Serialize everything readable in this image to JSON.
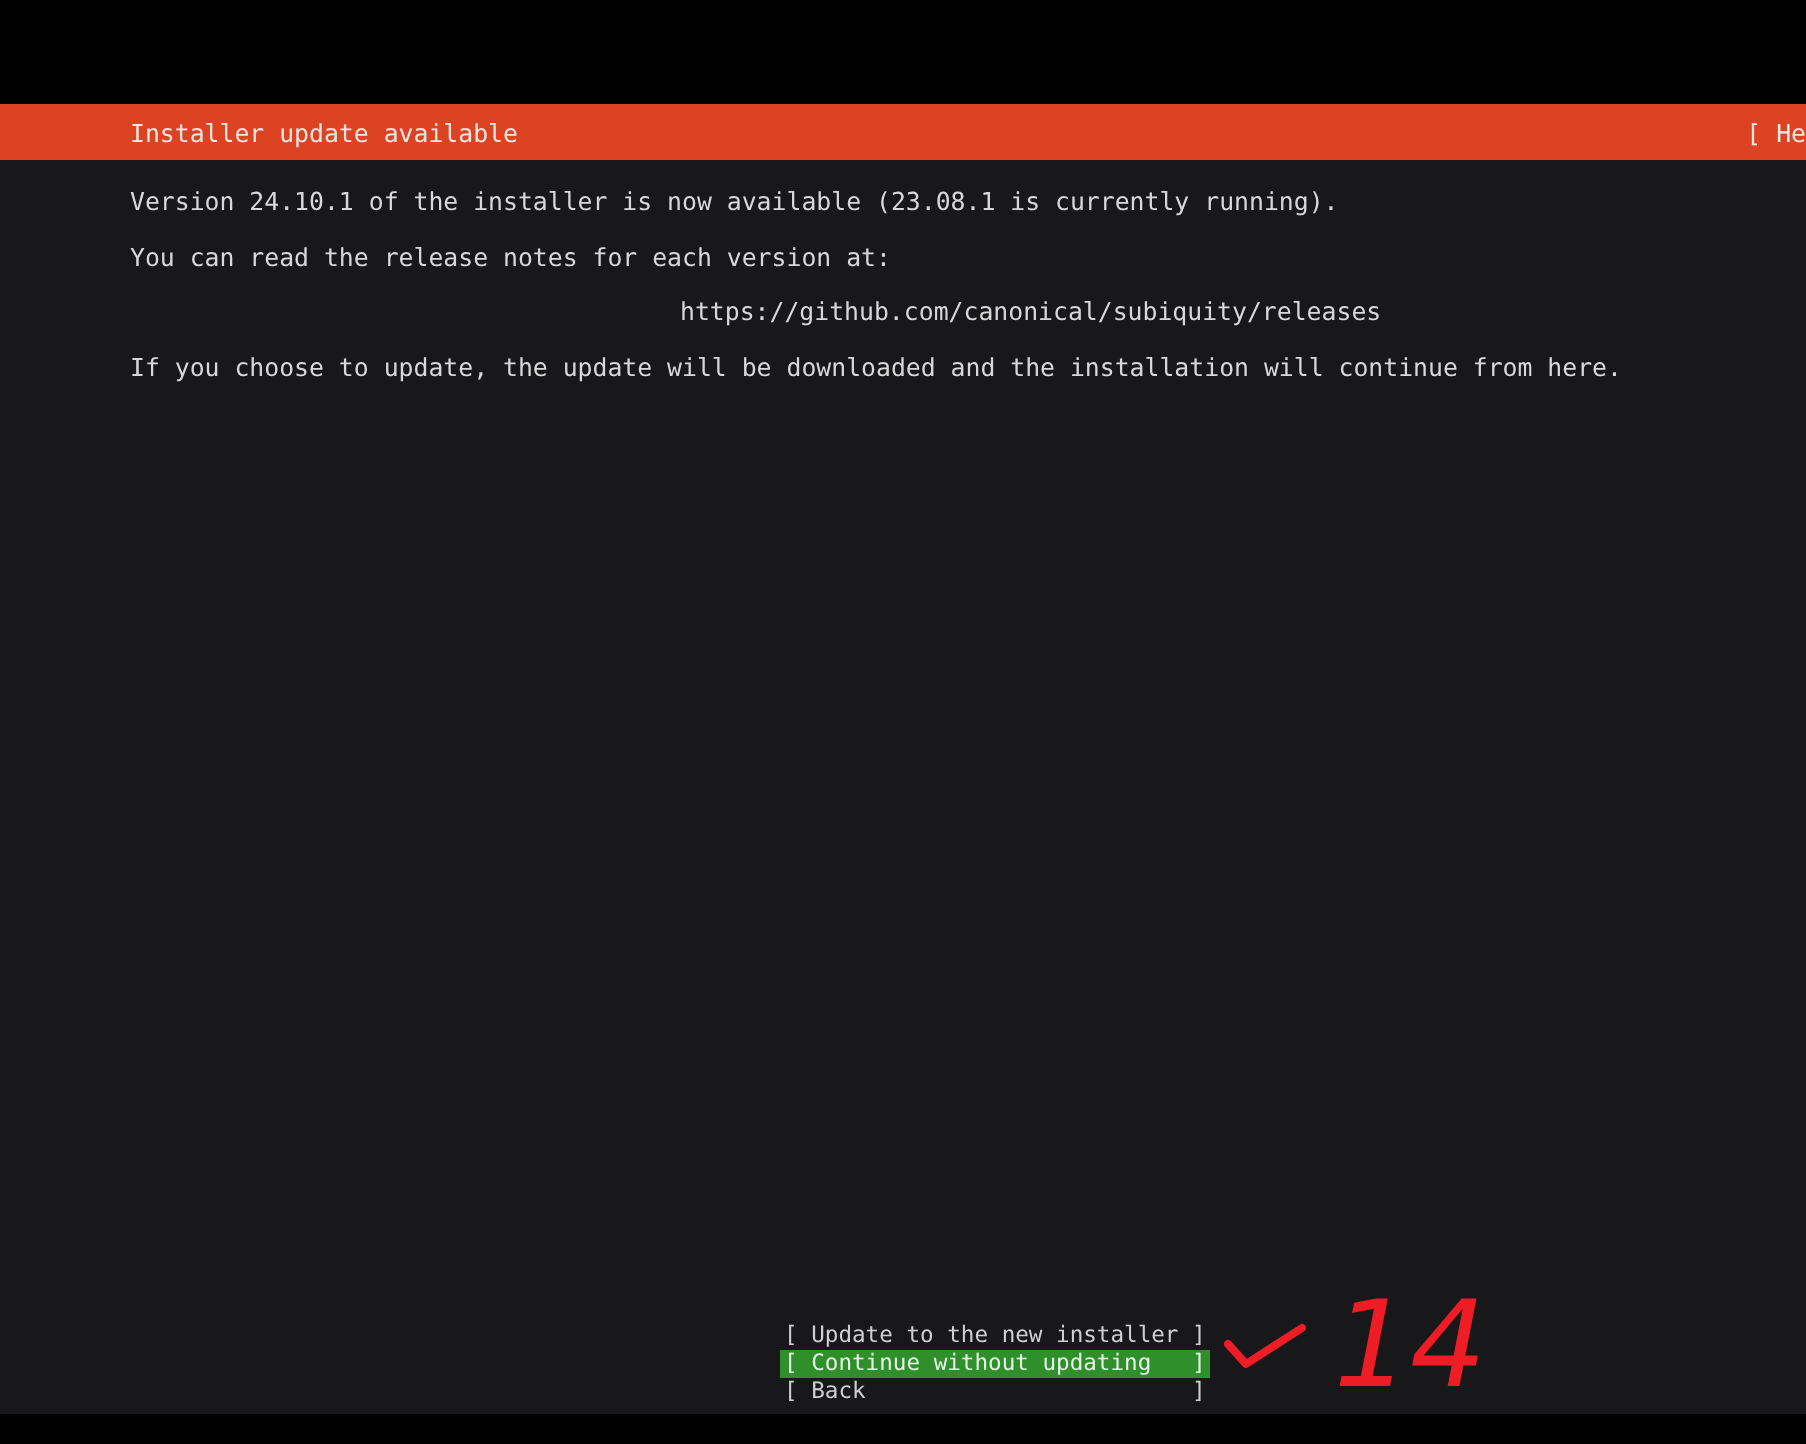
{
  "header": {
    "title": "Installer update available",
    "help": "[ He"
  },
  "body": {
    "paragraphs": [
      {
        "kind": "text",
        "text": "Version 24.10.1 of the installer is now available (23.08.1 is currently running)."
      },
      {
        "kind": "text",
        "text": "You can read the release notes for each version at:"
      },
      {
        "kind": "link",
        "text": "https://github.com/canonical/subiquity/releases"
      },
      {
        "kind": "text",
        "text": "If you choose to update, the update will be downloaded and the installation will continue from here."
      }
    ]
  },
  "buttons": [
    {
      "label": "[ Update to the new installer ]",
      "selected": false
    },
    {
      "label": "[ Continue without updating   ]",
      "selected": true
    },
    {
      "label": "[ Back                        ]",
      "selected": false
    }
  ],
  "annotation": {
    "text": "14"
  }
}
